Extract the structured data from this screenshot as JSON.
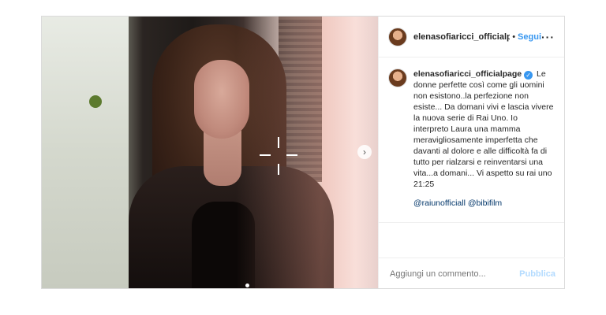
{
  "post": {
    "username": "elenasofiaricci_officialpa",
    "separator": "•",
    "follow_label": "Segui",
    "more_icon": "more-horizontal-icon",
    "caption_username": "elenasofiaricci_officialpage",
    "verified_mark": "✓",
    "caption_text": "Le donne perfette così come gli uomini non esistono..la perfezione non esiste... Da domani vivi e lascia vivere la nuova serie di Rai Uno. Io interpreto Laura una mamma meravigliosamente imperfetta che davanti al dolore e alle difficoltà fa di tutto per rialzarsi e reinventarsi una vita...a domani... Vi aspetto su rai uno 21:25",
    "mentions": "@raiunofficiall @bibifilm",
    "next_arrow": "›",
    "comment_placeholder": "Aggiungi un commento...",
    "publish_label": "Pubblica"
  },
  "colors": {
    "accent": "#3897f0",
    "publish_disabled": "#b3dbff",
    "text": "#262626",
    "muted": "#8e8e8e",
    "border": "#dbdbdb"
  }
}
